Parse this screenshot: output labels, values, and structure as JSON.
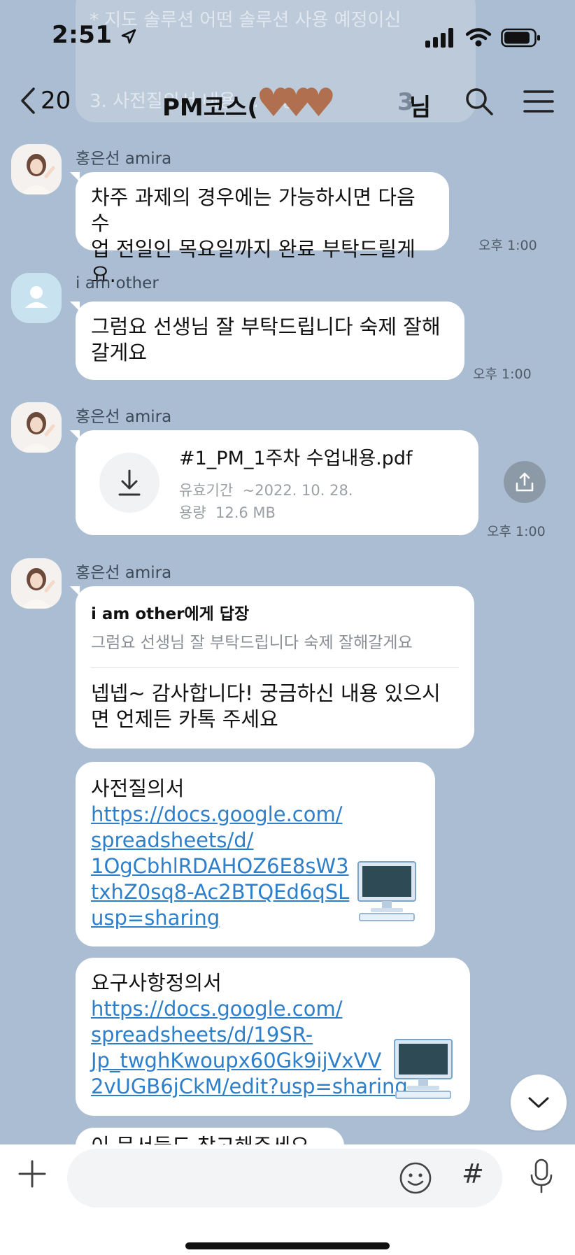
{
  "status_bar": {
    "time": "2:51"
  },
  "header": {
    "back_count": "20",
    "title": "PM코스(",
    "title_tail": "님",
    "member_count": "3",
    "hearts": "♥♥♥"
  },
  "background_preview": {
    "line1": "* 지도 솔루션 어떤 솔루션 사용 예정이신",
    "line2": "3. 사전질의서 내용 ... 방송"
  },
  "messages": [
    {
      "sender": "홍은선 amira",
      "text_line1": "차주 과제의 경우에는 가능하시면 다음 수",
      "text_line2": "업 전일인 목요일까지 완료 부탁드릴게요.",
      "time": "오후 1:00"
    },
    {
      "sender": "i am other",
      "text_line1": "그럼요 선생님 잘 부탁드립니다 숙제 잘해",
      "text_line2": "갈게요",
      "time": "오후 1:00"
    },
    {
      "sender": "홍은선 amira",
      "file_name": "#1_PM_1주차 수업내용.pdf",
      "file_expiry_label": "유효기간",
      "file_expiry": "~2022. 10. 28.",
      "file_size_label": "용량",
      "file_size": "12.6 MB",
      "time": "오후 1:00"
    },
    {
      "sender": "홍은선 amira",
      "reply_to": "i am other에게 답장",
      "reply_quote": "그럼요 선생님 잘 부탁드립니다 숙제 잘해갈게요",
      "text_line1": "넵넵~ 감사합니다! 궁금하신 내용 있으시",
      "text_line2": "면 언제든 카톡 주세요"
    },
    {
      "title": "사전질의서",
      "link_l1": "https://docs.google.com/",
      "link_l2": "spreadsheets/d/",
      "link_l3": "1OgCbhlRDAHOZ6E8sW3",
      "link_l4": "txhZ0sq8-Ac2BTQEd6qSL",
      "link_l5": "usp=sharing"
    },
    {
      "title": "요구사항정의서",
      "link_l1": "https://docs.google.com/",
      "link_l2": "spreadsheets/d/19SR-",
      "link_l3": "Jp_twghKwoupx60Gk9ijVxVV",
      "link_l4": "2vUGB6jCkM/edit?usp=sharing"
    },
    {
      "partial_text": "이 문서들도 참고해주세요"
    }
  ],
  "input": {
    "placeholder": ""
  },
  "colors": {
    "background": "#abbdd2",
    "bubble": "#ffffff",
    "link": "#2e7fc9"
  }
}
